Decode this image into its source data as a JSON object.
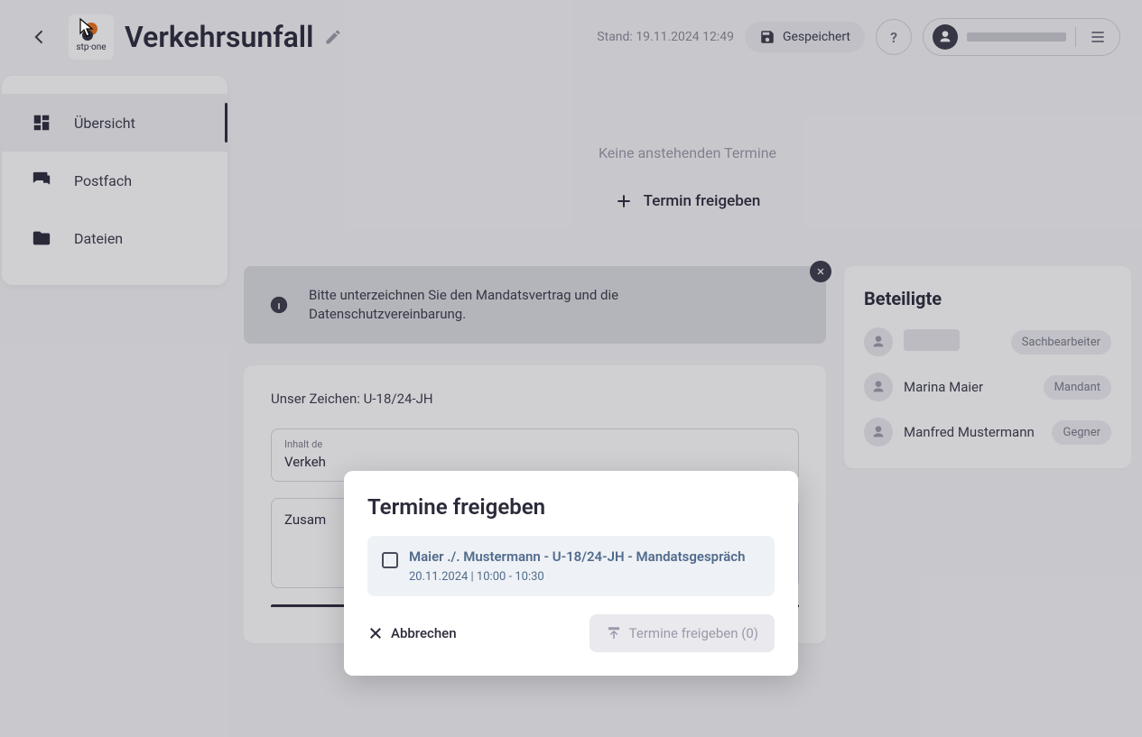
{
  "header": {
    "logo_text": "stp·one",
    "page_title": "Verkehrsunfall",
    "status_prefix": "Stand:",
    "status_time": "19.11.2024 12:49",
    "save_label": "Gespeichert",
    "help_label": "?"
  },
  "sidebar": {
    "items": [
      {
        "label": "Übersicht",
        "icon": "dashboard",
        "active": true
      },
      {
        "label": "Postfach",
        "icon": "chat",
        "active": false
      },
      {
        "label": "Dateien",
        "icon": "folder",
        "active": false
      }
    ]
  },
  "main": {
    "no_appointments": "Keine anstehenden Termine",
    "add_appointment_label": "Termin freigeben",
    "banner_text": "Bitte unterzeichnen Sie den Mandatsvertrag und die Datenschutzvereinbarung.",
    "reference_label": "Unser Zeichen: U-18/24-JH",
    "field1_label": "Inhalt de",
    "field1_value": "Verkeh",
    "field2_label": "Zusam"
  },
  "participants": {
    "heading": "Beteiligte",
    "rows": [
      {
        "name": "",
        "redacted": true,
        "role": "Sachbearbeiter"
      },
      {
        "name": "Marina Maier",
        "redacted": false,
        "role": "Mandant"
      },
      {
        "name": "Manfred Mustermann",
        "redacted": false,
        "role": "Gegner"
      }
    ]
  },
  "modal": {
    "title": "Termine freigeben",
    "item_title": "Maier ./. Mustermann - U-18/24-JH - Mandatsgespräch",
    "item_time": "20.11.2024 | 10:00 - 10:30",
    "cancel_label": "Abbrechen",
    "confirm_label": "Termine freigeben (0)"
  }
}
